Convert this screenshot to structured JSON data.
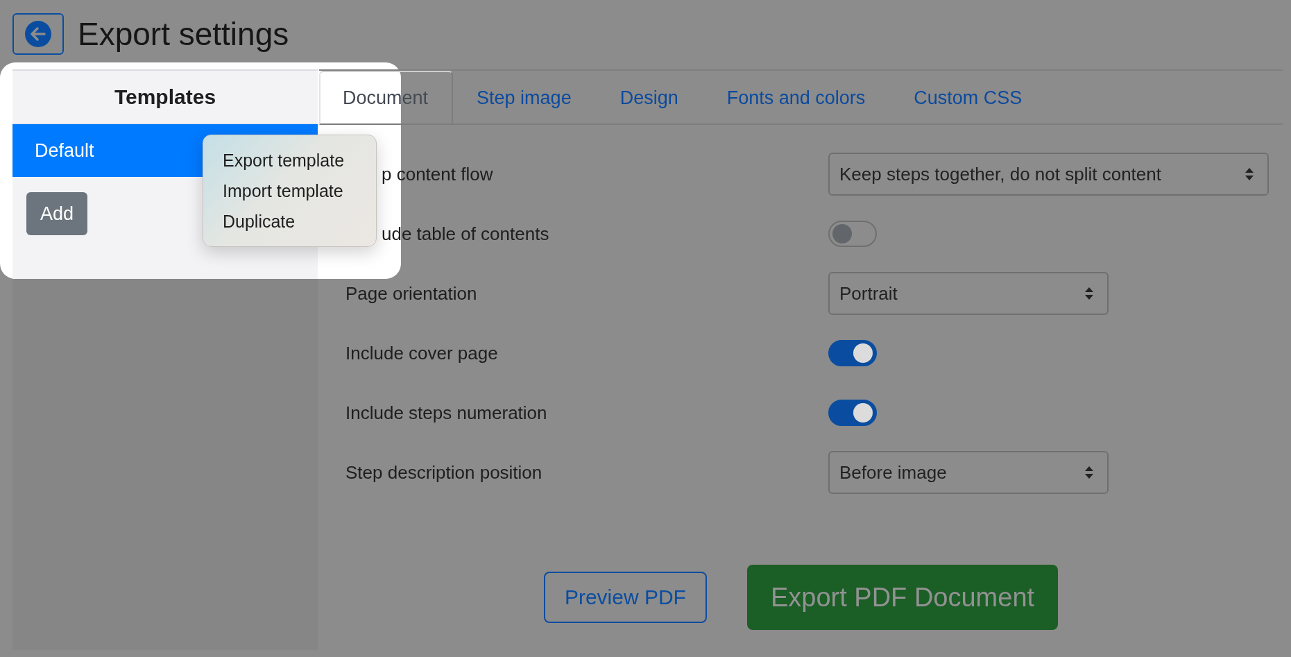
{
  "header": {
    "title": "Export settings"
  },
  "templates": {
    "title": "Templates",
    "items": [
      {
        "label": "Default",
        "selected": true
      }
    ],
    "add_button": "Add"
  },
  "context_menu": {
    "items": [
      "Export template",
      "Import template",
      "Duplicate"
    ]
  },
  "tabs": [
    {
      "label": "Document",
      "selected": true
    },
    {
      "label": "Step image",
      "selected": false
    },
    {
      "label": "Design",
      "selected": false
    },
    {
      "label": "Fonts and colors",
      "selected": false
    },
    {
      "label": "Custom CSS",
      "selected": false
    }
  ],
  "settings": [
    {
      "kind": "select",
      "label": "p content flow",
      "value": "Keep steps together, do not split content",
      "wide": true
    },
    {
      "kind": "toggle",
      "label": "ude table of contents",
      "on": false
    },
    {
      "kind": "select",
      "label": "Page orientation",
      "value": "Portrait",
      "wide": false
    },
    {
      "kind": "toggle",
      "label": "Include cover page",
      "on": true
    },
    {
      "kind": "toggle",
      "label": "Include steps numeration",
      "on": true
    },
    {
      "kind": "select",
      "label": "Step description position",
      "value": "Before image",
      "wide": false
    }
  ],
  "buttons": [
    {
      "label": "Preview PDF",
      "kind": "outline"
    },
    {
      "label": "Export PDF Document",
      "kind": "primary"
    }
  ]
}
